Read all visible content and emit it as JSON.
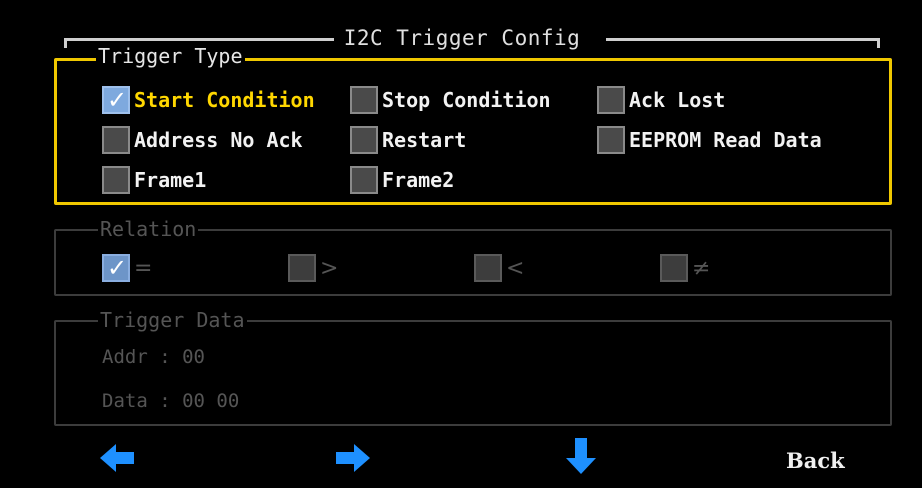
{
  "title": "I2C Trigger Config",
  "trigger_type": {
    "legend": "Trigger Type",
    "options": [
      {
        "label": "Start Condition",
        "checked": true
      },
      {
        "label": "Stop Condition",
        "checked": false
      },
      {
        "label": "Ack Lost",
        "checked": false
      },
      {
        "label": "Address No Ack",
        "checked": false
      },
      {
        "label": "Restart",
        "checked": false
      },
      {
        "label": "EEPROM Read Data",
        "checked": false
      },
      {
        "label": "Frame1",
        "checked": false
      },
      {
        "label": "Frame2",
        "checked": false
      }
    ]
  },
  "relation": {
    "legend": "Relation",
    "options": [
      {
        "label": "=",
        "checked": true
      },
      {
        "label": ">",
        "checked": false
      },
      {
        "label": "<",
        "checked": false
      },
      {
        "label": "≠",
        "checked": false
      }
    ]
  },
  "trigger_data": {
    "legend": "Trigger Data",
    "addr_label": "Addr",
    "addr_value": "00",
    "data_label": "Data",
    "data_value": "00 00"
  },
  "nav": {
    "back_label": "Back",
    "left_icon": "arrow-left-icon",
    "right_icon": "arrow-right-icon",
    "down_icon": "arrow-down-icon"
  },
  "colors": {
    "focus_border": "#f0c800",
    "selected_text": "#ffd700",
    "arrow": "#1e90ff",
    "checkbox_checked": "#7ea9de"
  }
}
